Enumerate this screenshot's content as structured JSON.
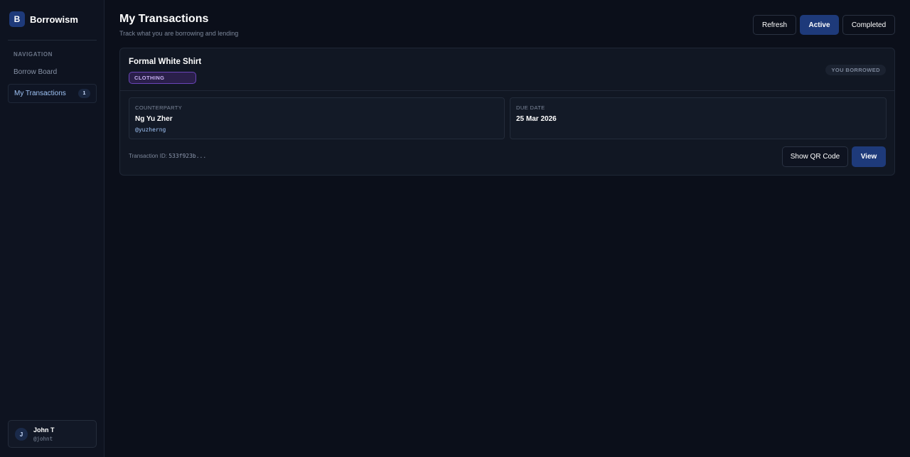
{
  "app": {
    "logo_letter": "B",
    "name": "Borrowism"
  },
  "sidebar": {
    "heading": "NAVIGATION",
    "items": [
      {
        "label": "Borrow Board"
      },
      {
        "label": "My Transactions",
        "count": "1"
      }
    ]
  },
  "user": {
    "initial": "J",
    "name": "John T",
    "handle": "@johnt"
  },
  "header": {
    "title": "My Transactions",
    "subtitle": "Track what you are borrowing and lending",
    "buttons": {
      "refresh": "Refresh",
      "active": "Active",
      "completed": "Completed"
    }
  },
  "transaction": {
    "item_name": "Formal White Shirt",
    "category": "CLOTHING",
    "role": "YOU BORROWED",
    "counterparty_label": "COUNTERPARTY",
    "counterparty_name": "Ng Yu Zher",
    "counterparty_handle": "@yuzherng",
    "due_label": "DUE DATE",
    "due_date": "25 Mar 2026",
    "id_label": "Transaction ID:",
    "id_value": "533f923b...",
    "qr_button": "Show QR Code",
    "view_button": "View"
  },
  "colors": {
    "accent": "#1e3a7a",
    "background": "#0b0f1a",
    "category_badge": "#6a45b8"
  }
}
